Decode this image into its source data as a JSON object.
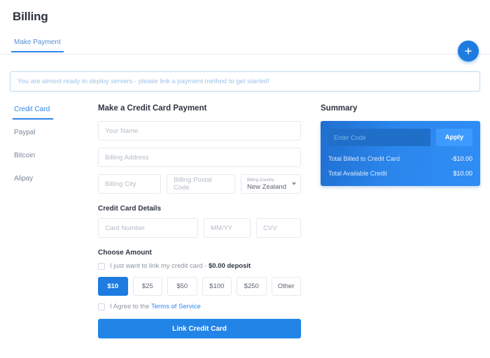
{
  "header": {
    "title": "Billing",
    "tabs": [
      {
        "label": "Make Payment",
        "active": true
      }
    ],
    "fab_icon": "plus-icon"
  },
  "alert": {
    "message": "You are almost ready to deploy servers - please link a payment method to get started!"
  },
  "payment_methods": [
    {
      "label": "Credit Card",
      "active": true
    },
    {
      "label": "Paypal",
      "active": false
    },
    {
      "label": "Bitcoin",
      "active": false
    },
    {
      "label": "Alipay",
      "active": false
    }
  ],
  "form": {
    "title": "Make a Credit Card Payment",
    "name_placeholder": "Your Name",
    "address_placeholder": "Billing Address",
    "city_placeholder": "Billing City",
    "postal_placeholder": "Billing Postal Code",
    "country_label": "Billing Country",
    "country_value": "New Zealand",
    "card_section_title": "Credit Card Details",
    "card_number_placeholder": "Card Number",
    "expiry_placeholder": "MM/YY",
    "cvv_placeholder": "CVV",
    "amount_section_title": "Choose Amount",
    "link_only_text": "I just want to link my credit card - ",
    "link_only_amount": "$0.00 deposit",
    "amounts": [
      {
        "label": "$10",
        "selected": true
      },
      {
        "label": "$25",
        "selected": false
      },
      {
        "label": "$50",
        "selected": false
      },
      {
        "label": "$100",
        "selected": false
      },
      {
        "label": "$250",
        "selected": false
      },
      {
        "label": "Other",
        "selected": false
      }
    ],
    "terms_text": "I Agree to the ",
    "terms_link": "Terms of Service",
    "submit_label": "Link Credit Card"
  },
  "summary": {
    "title": "Summary",
    "coupon_placeholder": "Enter Code",
    "apply_label": "Apply",
    "rows": [
      {
        "label": "Total Billed to Credit Card",
        "value": "-$10.00"
      },
      {
        "label": "Total Available Credit",
        "value": "$10.00"
      }
    ]
  },
  "colors": {
    "accent": "#2f86eb",
    "accent_dark": "#1e7ce0",
    "panel_gradient_start": "#1f6fd0",
    "panel_gradient_end": "#2f8ef5",
    "apply_button": "#3d9bff",
    "muted_text": "#8d96a1",
    "border": "#e6e9ed"
  }
}
